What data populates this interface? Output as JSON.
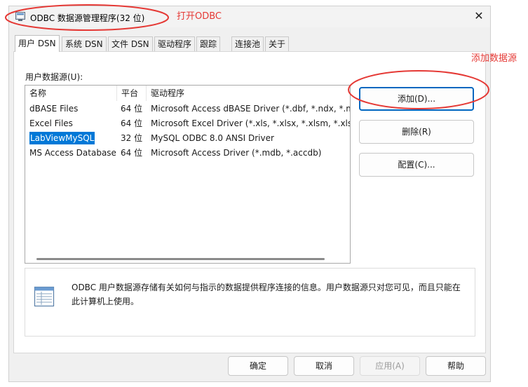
{
  "window": {
    "title": "ODBC 数据源管理程序(32 位)",
    "close_glyph": "✕"
  },
  "tabs": [
    {
      "label": "用户 DSN",
      "active": true
    },
    {
      "label": "系统 DSN"
    },
    {
      "label": "文件 DSN"
    },
    {
      "label": "驱动程序"
    },
    {
      "label": "跟踪"
    },
    {
      "label": "连接池"
    },
    {
      "label": "关于"
    }
  ],
  "user_dsn": {
    "section_label": "用户数据源(U):",
    "columns": [
      "名称",
      "平台",
      "驱动程序"
    ],
    "rows": [
      {
        "name": "dBASE Files",
        "platform": "64 位",
        "driver": "Microsoft Access dBASE Driver (*.dbf, *.ndx, *.mdx)"
      },
      {
        "name": "Excel Files",
        "platform": "64 位",
        "driver": "Microsoft Excel Driver (*.xls, *.xlsx, *.xlsm, *.xlsb)"
      },
      {
        "name": "LabViewMySQL",
        "platform": "32 位",
        "driver": "MySQL ODBC 8.0 ANSI Driver",
        "selected": true
      },
      {
        "name": "MS Access Database",
        "platform": "64 位",
        "driver": "Microsoft Access Driver (*.mdb, *.accdb)"
      }
    ],
    "buttons": {
      "add": "添加(D)...",
      "remove": "删除(R)",
      "configure": "配置(C)..."
    },
    "info_text": "ODBC 用户数据源存储有关如何与指示的数据提供程序连接的信息。用户数据源只对您可见，而且只能在此计算机上使用。"
  },
  "footer_buttons": {
    "ok": "确定",
    "cancel": "取消",
    "apply": "应用(A)",
    "help": "帮助"
  },
  "annotations": {
    "open_odbc": "打开ODBC",
    "add_datasource": "添加数据源",
    "color": "#e53935"
  },
  "colors": {
    "selection": "#0078d7",
    "primary_border": "#0067c0"
  }
}
